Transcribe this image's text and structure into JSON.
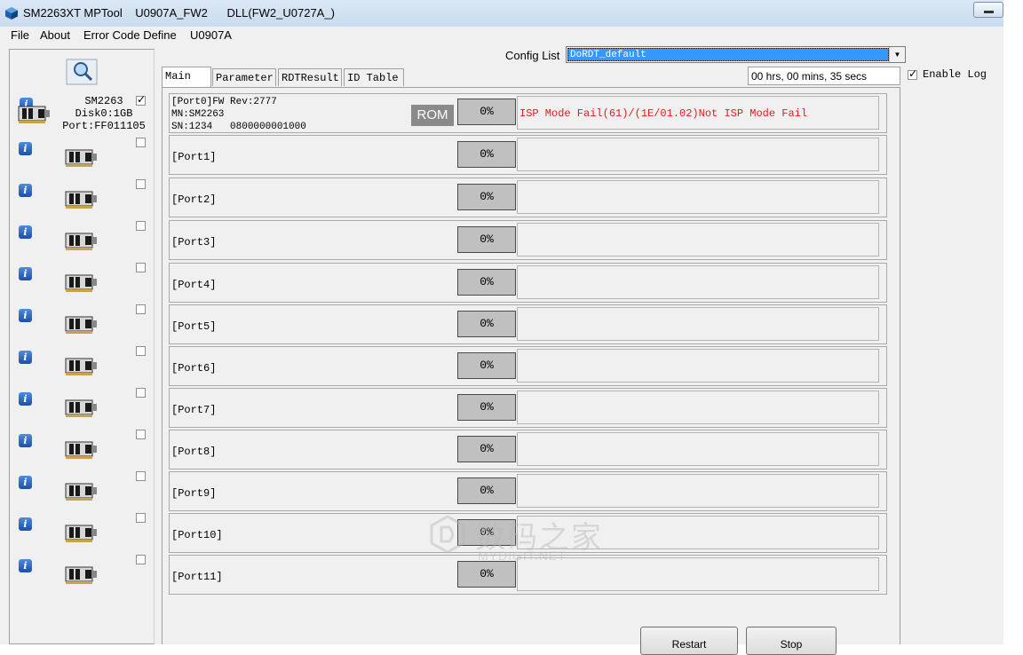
{
  "window": {
    "title": "SM2263XT MPTool    U0907A_FW2      DLL(FW2_U0727A_)"
  },
  "menu": [
    "File",
    "About",
    "Error Code Define",
    "U0907A"
  ],
  "config": {
    "label": "Config List",
    "value": "DoRDT_default"
  },
  "timer": "00 hrs, 00 mins, 35 secs",
  "enable_log": {
    "label": "Enable Log",
    "checked": true
  },
  "tabs": [
    "Main",
    "Parameter",
    "RDTResult",
    "ID Table"
  ],
  "devices": [
    {
      "lines": [
        "SM2263",
        "Disk0:1GB",
        "Port:FF011105"
      ],
      "checked": true
    },
    {
      "checked": false
    },
    {
      "checked": false
    },
    {
      "checked": false
    },
    {
      "checked": false
    },
    {
      "checked": false
    },
    {
      "checked": false
    },
    {
      "checked": false
    },
    {
      "checked": false
    },
    {
      "checked": false
    },
    {
      "checked": false
    },
    {
      "checked": false
    }
  ],
  "ports": [
    {
      "info": [
        "[Port0]FW Rev:2777",
        "MN:SM2263",
        "SN:1234   0800000001000"
      ],
      "badge": "ROM",
      "progress": "0%",
      "status": "ISP Mode Fail(61)/(1E/01.02)Not ISP Mode Fail"
    },
    {
      "label": "[Port1]",
      "progress": "0%"
    },
    {
      "label": "[Port2]",
      "progress": "0%"
    },
    {
      "label": "[Port3]",
      "progress": "0%"
    },
    {
      "label": "[Port4]",
      "progress": "0%"
    },
    {
      "label": "[Port5]",
      "progress": "0%"
    },
    {
      "label": "[Port6]",
      "progress": "0%"
    },
    {
      "label": "[Port7]",
      "progress": "0%"
    },
    {
      "label": "[Port8]",
      "progress": "0%"
    },
    {
      "label": "[Port9]",
      "progress": "0%"
    },
    {
      "label": "[Port10]",
      "progress": "0%"
    },
    {
      "label": "[Port11]",
      "progress": "0%"
    }
  ],
  "buttons": {
    "restart": "Restart",
    "stop": "Stop"
  },
  "watermark": {
    "zh": "数码之家",
    "en": "MYDIGIT.NET"
  }
}
